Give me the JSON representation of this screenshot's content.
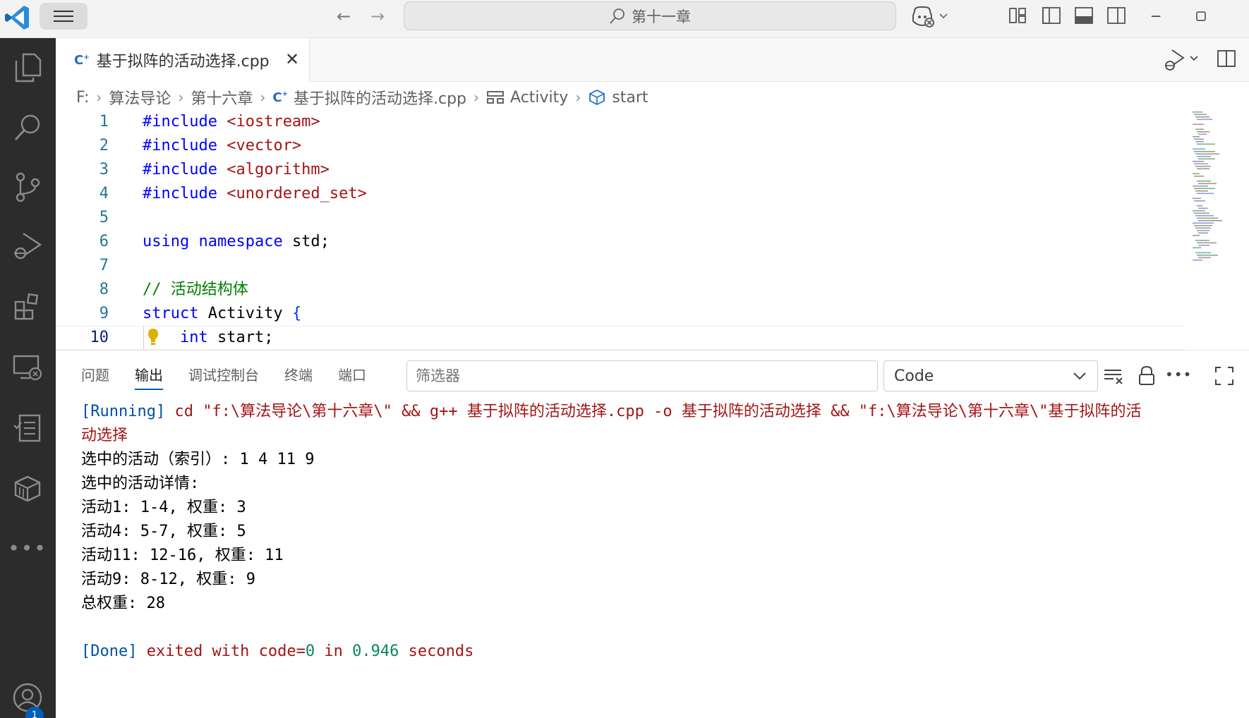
{
  "titlebar": {
    "search_text": "第十一章",
    "icons": [
      "vscode-logo",
      "menu-icon",
      "arrow-left-icon",
      "arrow-right-icon",
      "search-icon",
      "copilot-icon",
      "customize-layout-icon",
      "toggle-sidebar-icon",
      "toggle-panel-icon",
      "toggle-secondary-sidebar-icon",
      "minimize-icon",
      "maximize-icon"
    ]
  },
  "activitybar": {
    "items": [
      "explorer-icon",
      "search-icon",
      "source-control-icon",
      "run-debug-icon",
      "extensions-icon",
      "remote-explorer-icon",
      "testing-icon",
      "containers-icon",
      "more-icon",
      "account-icon"
    ],
    "account_badge": "1"
  },
  "tabs": {
    "active_tab": "基于拟阵的活动选择.cpp",
    "close_glyph": "✕"
  },
  "breadcrumb": {
    "items": [
      "F:",
      "算法导论",
      "第十六章",
      "基于拟阵的活动选择.cpp",
      "Activity",
      "start"
    ]
  },
  "editor": {
    "current_line": 10,
    "lines": [
      {
        "n": "1",
        "tokens": [
          [
            "inc",
            "#include "
          ],
          [
            "str",
            "<iostream>"
          ]
        ]
      },
      {
        "n": "2",
        "tokens": [
          [
            "inc",
            "#include "
          ],
          [
            "str",
            "<vector>"
          ]
        ]
      },
      {
        "n": "3",
        "tokens": [
          [
            "inc",
            "#include "
          ],
          [
            "str",
            "<algorithm>"
          ]
        ]
      },
      {
        "n": "4",
        "tokens": [
          [
            "inc",
            "#include "
          ],
          [
            "str",
            "<unordered_set>"
          ]
        ]
      },
      {
        "n": "5",
        "tokens": []
      },
      {
        "n": "6",
        "tokens": [
          [
            "kw",
            "using "
          ],
          [
            "kw",
            "namespace "
          ],
          [
            "id",
            "std"
          ],
          [
            "punc",
            ";"
          ]
        ]
      },
      {
        "n": "7",
        "tokens": []
      },
      {
        "n": "8",
        "tokens": [
          [
            "cmt",
            "// 活动结构体"
          ]
        ]
      },
      {
        "n": "9",
        "tokens": [
          [
            "kw",
            "struct "
          ],
          [
            "id",
            "Activity "
          ],
          [
            "brace",
            "{"
          ]
        ]
      },
      {
        "n": "10",
        "tokens": [
          [
            "id",
            "    "
          ],
          [
            "kw",
            "int "
          ],
          [
            "id",
            "start"
          ],
          [
            "punc",
            ";"
          ]
        ]
      }
    ]
  },
  "panel": {
    "tabs": [
      "问题",
      "输出",
      "调试控制台",
      "终端",
      "端口"
    ],
    "active_tab": "输出",
    "filter_placeholder": "筛选器",
    "channel": "Code",
    "output": [
      [
        [
          "o-tag",
          "[Running] "
        ],
        [
          "o-cmd",
          "cd \"f:\\算法导论\\第十六章\\\" && g++ 基于拟阵的活动选择.cpp -o 基于拟阵的活动选择 && \"f:\\算法导论\\第十六章\\\"基于拟阵的活"
        ]
      ],
      [
        [
          "o-cmd",
          "动选择"
        ]
      ],
      [
        [
          "plain",
          "选中的活动（索引）: 1 4 11 9"
        ]
      ],
      [
        [
          "plain",
          "选中的活动详情:"
        ]
      ],
      [
        [
          "plain",
          "活动1: 1-4, 权重: 3"
        ]
      ],
      [
        [
          "plain",
          "活动4: 5-7, 权重: 5"
        ]
      ],
      [
        [
          "plain",
          "活动11: 12-16, 权重: 11"
        ]
      ],
      [
        [
          "plain",
          "活动9: 8-12, 权重: 9"
        ]
      ],
      [
        [
          "plain",
          "总权重: 28"
        ]
      ],
      [
        [
          "plain",
          ""
        ]
      ],
      [
        [
          "o-tag",
          "[Done] "
        ],
        [
          "o-cmd",
          "exited "
        ],
        [
          "o-cmd",
          "with "
        ],
        [
          "o-cmd",
          "code="
        ],
        [
          "o-num",
          "0"
        ],
        [
          "o-cmd",
          " in "
        ],
        [
          "o-num",
          "0.946"
        ],
        [
          "o-cmd",
          " seconds"
        ]
      ]
    ]
  },
  "colors": {
    "activitybar_bg": "#2c2c2c",
    "accent": "#005fb8",
    "keyword": "#0000ff",
    "string": "#a31515",
    "comment": "#008000"
  }
}
